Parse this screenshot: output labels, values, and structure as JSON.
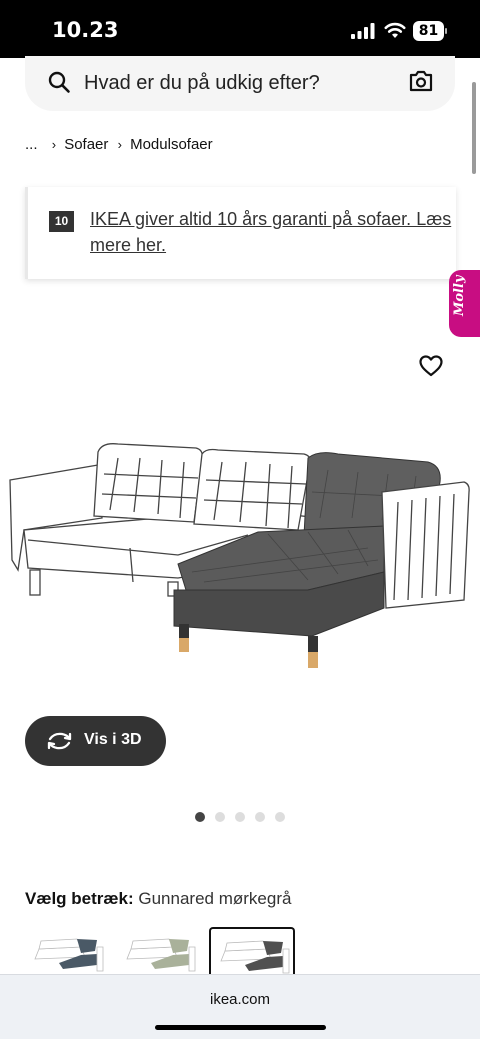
{
  "status": {
    "time": "10.23",
    "battery": "81"
  },
  "search": {
    "placeholder": "Hvad er du på udkig efter?"
  },
  "breadcrumb": {
    "ellipsis": "...",
    "items": [
      "Sofaer",
      "Modulsofaer"
    ]
  },
  "banner": {
    "badge": "10",
    "text": "IKEA giver altid 10 års garanti på sofaer. Læs mere her."
  },
  "assistant": {
    "label": "Molly",
    "color": "#c80d82"
  },
  "product": {
    "vis3d_label": "Vis i 3D",
    "image_dots": {
      "count": 5,
      "active_index": 0
    }
  },
  "cover": {
    "label": "Vælg betræk:",
    "value": "Gunnared mørkegrå"
  },
  "swatches": [
    {
      "name": "blue-grey cover",
      "color": "#4a5966",
      "selected": false
    },
    {
      "name": "light green cover",
      "color": "#a9b19a",
      "selected": false
    },
    {
      "name": "dark grey cover",
      "color": "#505050",
      "selected": true
    }
  ],
  "browser": {
    "url": "ikea.com"
  },
  "icons": [
    "search-icon",
    "camera-icon",
    "heart-icon",
    "rotate-3d-icon",
    "signal-icon",
    "wifi-icon",
    "battery-icon"
  ]
}
